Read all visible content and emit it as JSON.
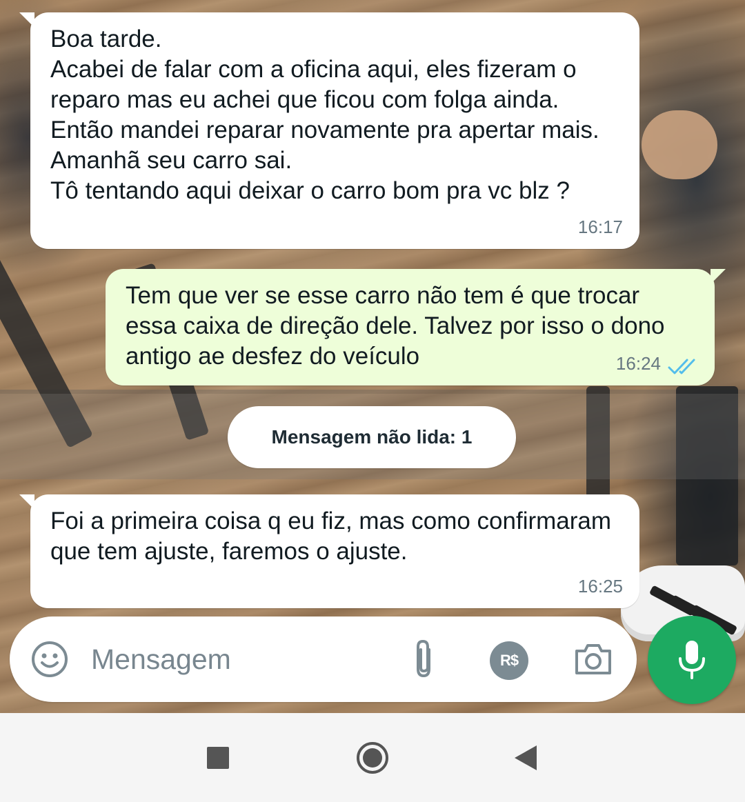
{
  "messages": [
    {
      "direction": "incoming",
      "text": "Boa tarde.\nAcabei de falar com a oficina aqui, eles fizeram o reparo mas eu achei que ficou com folga ainda.\nEntão mandei reparar novamente pra apertar mais. Amanhã seu carro sai.\nTô tentando aqui deixar o carro bom pra vc blz ?",
      "time": "16:17"
    },
    {
      "direction": "outgoing",
      "text": "Tem que ver se esse carro não tem é que trocar essa caixa de direção dele. Talvez por isso o dono antigo ae desfez do veículo",
      "time": "16:24",
      "status": "read",
      "status_icon": "double-check-icon"
    },
    {
      "direction": "incoming",
      "text": "Foi a primeira coisa q eu fiz, mas como confirmaram que tem ajuste, faremos o ajuste.",
      "time": "16:25"
    }
  ],
  "unread_divider": {
    "label": "Mensagem não lida: 1"
  },
  "composer": {
    "placeholder": "Mensagem",
    "value": "",
    "emoji_icon": "emoji-icon",
    "attach_icon": "paperclip-icon",
    "payment_label": "R$",
    "camera_icon": "camera-icon",
    "mic_icon": "microphone-icon"
  },
  "system_nav": {
    "recent_icon": "square-icon",
    "home_icon": "circle-icon",
    "back_icon": "triangle-back-icon"
  },
  "colors": {
    "incoming_bubble": "#ffffff",
    "outgoing_bubble": "#eefed9",
    "accent_green": "#1daa61",
    "read_tick": "#53bdeb",
    "timestamp": "#667781"
  }
}
